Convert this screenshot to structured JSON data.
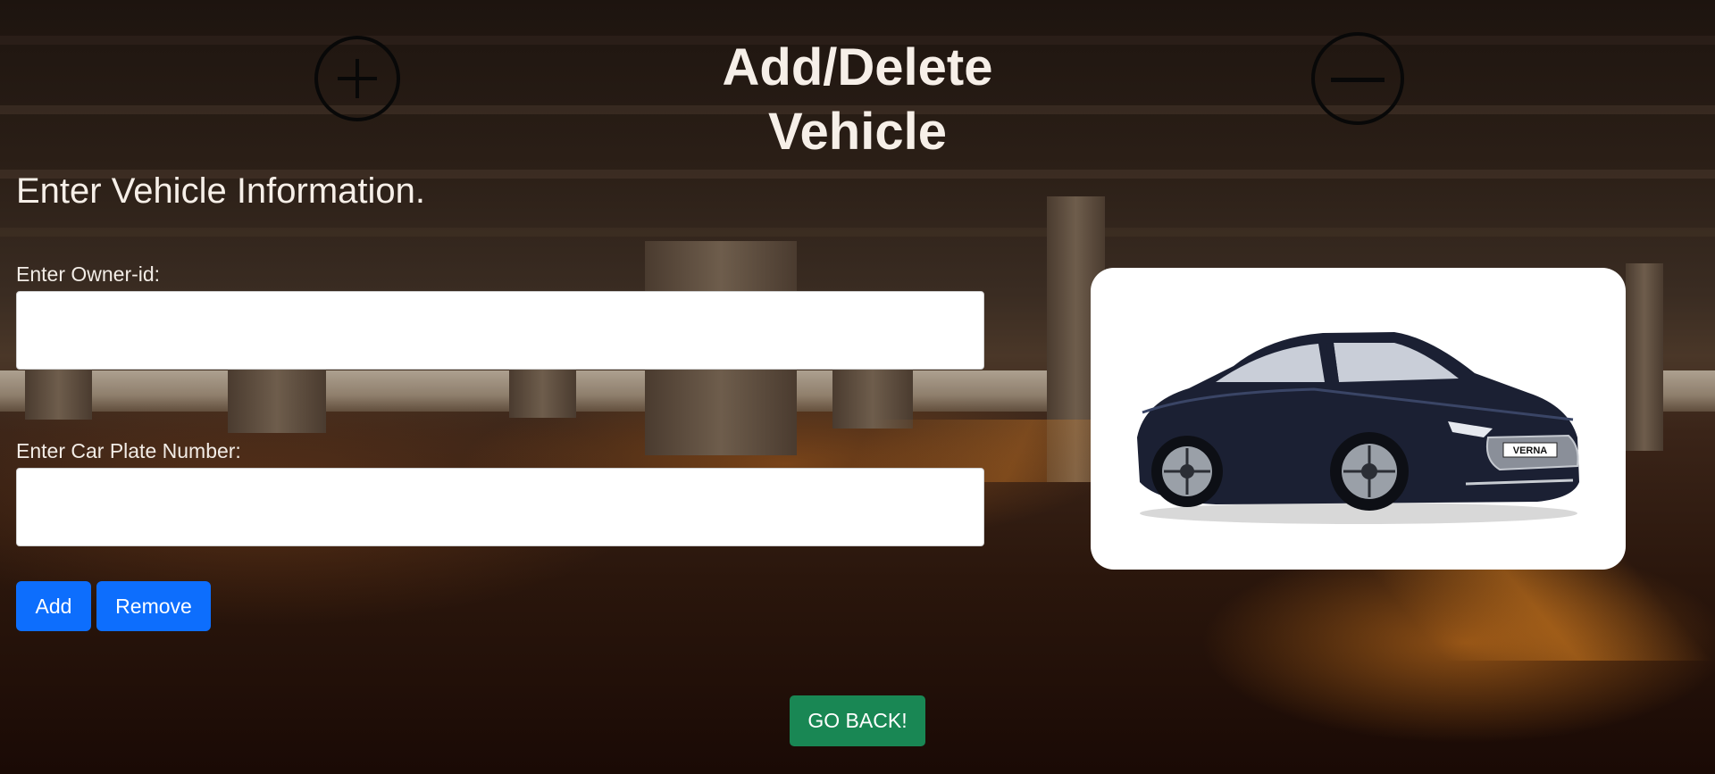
{
  "page": {
    "title": "Add/Delete Vehicle",
    "subtitle": "Enter Vehicle Information."
  },
  "icons": {
    "add": "plus-circle-icon",
    "remove": "minus-circle-icon"
  },
  "form": {
    "owner_label": "Enter Owner-id:",
    "owner_value": "",
    "plate_label": "Enter Car Plate Number:",
    "plate_value": "",
    "add_label": "Add",
    "remove_label": "Remove"
  },
  "car_image": {
    "plate_text": "VERNA"
  },
  "footer": {
    "back_label": "GO BACK!"
  },
  "colors": {
    "primary": "#0d6efd",
    "success": "#198754",
    "text_light": "#f6efe8",
    "car_body": "#1b2033"
  }
}
